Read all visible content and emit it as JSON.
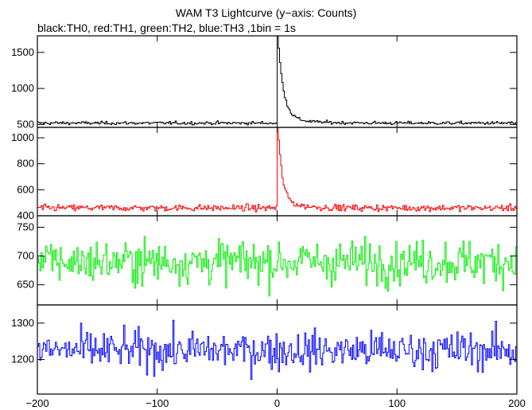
{
  "figure": {
    "title": "WAM T3 Lightcurve (y−axis: Counts)",
    "subtitle": "black:TH0, red:TH1, green:TH2, blue:TH3 ,1bin = 1s"
  },
  "chart_data": {
    "type": "line",
    "x_range": [
      -200,
      200
    ],
    "x_ticks": [
      -200,
      -100,
      0,
      100,
      200
    ],
    "x_tick_labels": [
      "−200",
      "−100",
      "0",
      "100",
      "200"
    ],
    "grid": false,
    "panels": [
      {
        "name": "TH0",
        "color": "#000000",
        "ylim": [
          460,
          1730
        ],
        "yticks": [
          500,
          1000,
          1500
        ],
        "ytick_labels": [
          "500",
          "1000",
          "1500"
        ],
        "baseline": 520,
        "noise": 18,
        "burst": {
          "t0": 0,
          "peak": 1700,
          "decay_s": 4.5,
          "tail_amp": 90,
          "tail_decay_s": 18
        }
      },
      {
        "name": "TH1",
        "color": "#ff0000",
        "ylim": [
          400,
          1080
        ],
        "yticks": [
          400,
          600,
          800,
          1000
        ],
        "ytick_labels": [
          "400",
          "600",
          "800",
          "1000"
        ],
        "baseline": 460,
        "noise": 20,
        "burst": {
          "t0": 0,
          "peak": 1070,
          "decay_s": 3.5,
          "tail_amp": 60,
          "tail_decay_s": 15
        }
      },
      {
        "name": "TH2",
        "color": "#00ee00",
        "ylim": [
          615,
          770
        ],
        "yticks": [
          650,
          700,
          750
        ],
        "ytick_labels": [
          "650",
          "700",
          "750"
        ],
        "baseline": 690,
        "noise": 30,
        "burst": null
      },
      {
        "name": "TH3",
        "color": "#0000ff",
        "ylim": [
          1105,
          1350
        ],
        "yticks": [
          1200,
          1300
        ],
        "ytick_labels": [
          "1200",
          "1300"
        ],
        "baseline": 1225,
        "noise": 42,
        "burst": null
      }
    ]
  }
}
